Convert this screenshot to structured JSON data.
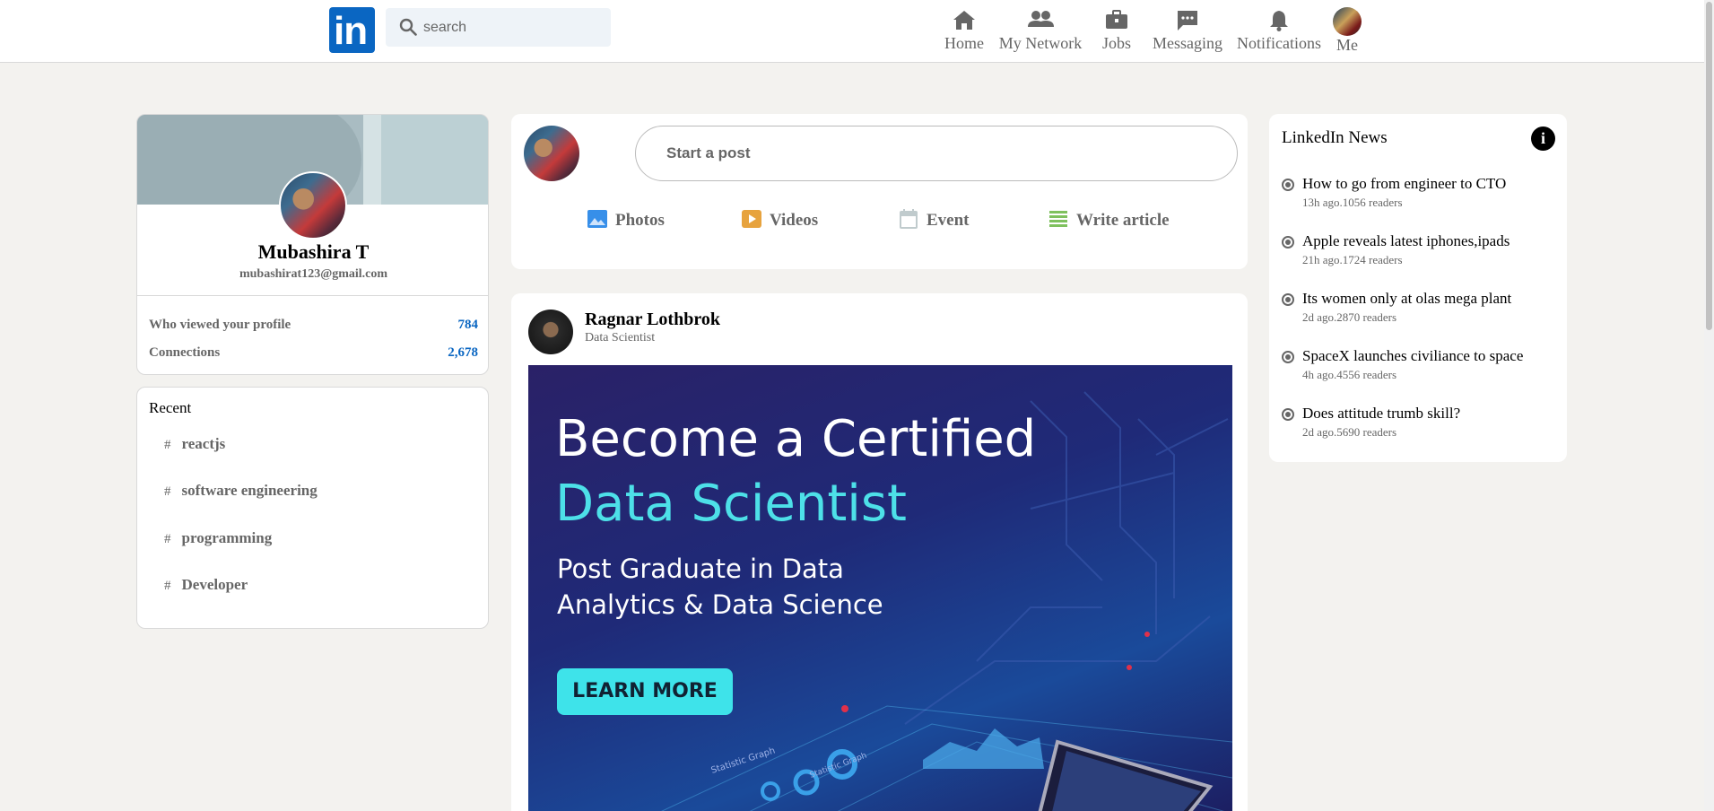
{
  "header": {
    "logo_text": "in",
    "search_placeholder": "search",
    "nav": [
      {
        "label": "Home",
        "icon": "home-icon"
      },
      {
        "label": "My Network",
        "icon": "people-icon"
      },
      {
        "label": "Jobs",
        "icon": "briefcase-icon"
      },
      {
        "label": "Messaging",
        "icon": "message-icon"
      },
      {
        "label": "Notifications",
        "icon": "bell-icon"
      },
      {
        "label": "Me",
        "icon": "avatar"
      }
    ]
  },
  "profile": {
    "name": "Mubashira T",
    "email": "mubashirat123@gmail.com",
    "stats": [
      {
        "label": "Who viewed your profile",
        "value": "784"
      },
      {
        "label": "Connections",
        "value": "2,678"
      }
    ]
  },
  "recent": {
    "title": "Recent",
    "hash": "#",
    "tags": [
      "reactjs",
      "software engineering",
      "programming",
      "Developer"
    ]
  },
  "post_box": {
    "start_post_label": "Start a post",
    "actions": [
      {
        "label": "Photos",
        "icon": "photo-icon",
        "color": "#378fe9"
      },
      {
        "label": "Videos",
        "icon": "video-icon",
        "color": "#e7a33e"
      },
      {
        "label": "Event",
        "icon": "calendar-icon",
        "color": "#c0cbcd"
      },
      {
        "label": "Write article",
        "icon": "article-icon",
        "color": "#7fc15e"
      }
    ]
  },
  "feed": {
    "author": "Ragnar Lothbrok",
    "role": "Data Scientist",
    "image": {
      "line1": "Become a Certified",
      "line2": "Data Scientist",
      "sub1": "Post Graduate in Data",
      "sub2": "Analytics & Data Science",
      "cta": "LEARN MORE",
      "label_a": "Statistic Graph",
      "label_b": "Statistic Graph"
    }
  },
  "news": {
    "title": "LinkedIn News",
    "items": [
      {
        "headline": "How to go from engineer to CTO",
        "meta": "13h ago.1056 readers"
      },
      {
        "headline": "Apple reveals latest iphones,ipads",
        "meta": "21h ago.1724 readers"
      },
      {
        "headline": "Its women only at olas mega plant",
        "meta": "2d ago.2870 readers"
      },
      {
        "headline": "SpaceX launches civiliance to space",
        "meta": "4h ago.4556 readers"
      },
      {
        "headline": "Does attitude trumb skill?",
        "meta": "2d ago.5690 readers"
      }
    ]
  },
  "colors": {
    "brand": "#0a66c2",
    "page_bg": "#f3f2ef",
    "cta": "#3ee3ea",
    "accent_text": "#4de0e8"
  }
}
